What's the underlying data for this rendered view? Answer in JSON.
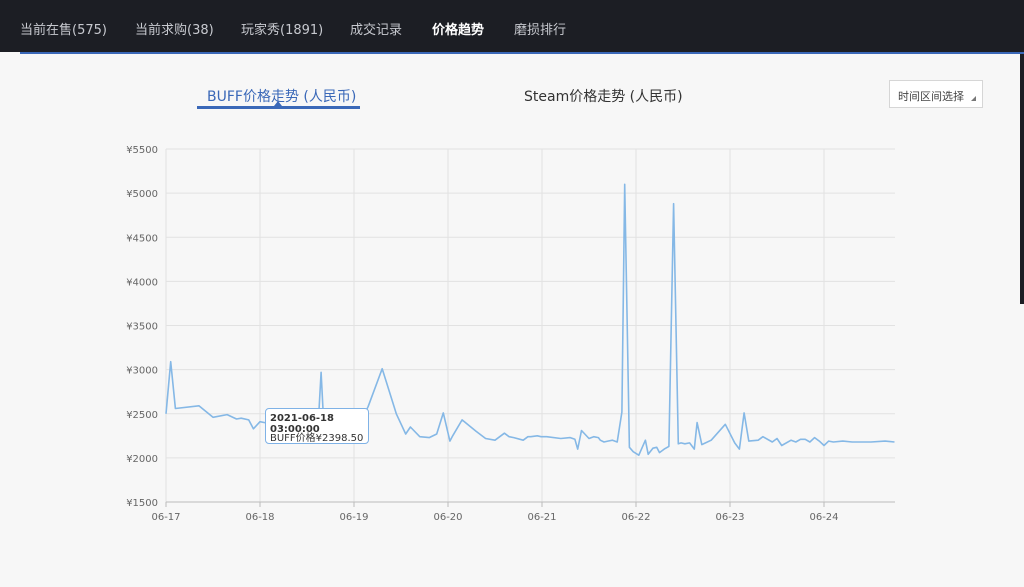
{
  "nav": {
    "tabs": [
      {
        "label": "当前在售(575)"
      },
      {
        "label": "当前求购(38)"
      },
      {
        "label": "玩家秀(1891)"
      },
      {
        "label": "成交记录"
      },
      {
        "label": "价格趋势"
      },
      {
        "label": "磨损排行"
      }
    ],
    "active_index": 4
  },
  "chart_tabs": {
    "buff_label": "BUFF价格走势 (人民币)",
    "steam_label": "Steam价格走势 (人民币)",
    "active": "buff"
  },
  "range_select": {
    "label": "时间区间选择"
  },
  "tooltip": {
    "time": "2021-06-18 03:00:00",
    "text": "BUFF价格¥2398.50"
  },
  "colors": {
    "accent": "#3a68b8",
    "line": "#85b8e6",
    "topbar": "#1c1e24"
  },
  "chart_data": {
    "type": "line",
    "ylim": [
      1500,
      5500
    ],
    "yticks": [
      "¥5500",
      "¥5000",
      "¥4500",
      "¥4000",
      "¥3500",
      "¥3000",
      "¥2500",
      "¥2000",
      "¥1500"
    ],
    "xticks": [
      "06-17",
      "06-18",
      "06-19",
      "06-20",
      "06-21",
      "06-22",
      "06-23",
      "06-24"
    ],
    "x_start": "2021-06-17 00:00",
    "grid": true,
    "series": [
      {
        "x": [
          0,
          0.05,
          0.1,
          0.35,
          0.5,
          0.65,
          0.75,
          0.8,
          0.88,
          0.93,
          1.0,
          1.05,
          1.15,
          1.25,
          1.4,
          1.5,
          1.55,
          1.62,
          1.65,
          1.68,
          1.72,
          1.8,
          1.9,
          1.98,
          2.05,
          2.15,
          2.3,
          2.45,
          2.55,
          2.6,
          2.7,
          2.8,
          2.88,
          2.95,
          3.02,
          3.05,
          3.15,
          3.3,
          3.4,
          3.5,
          3.6,
          3.65,
          3.7,
          3.8,
          3.85,
          3.88,
          3.95,
          3.99,
          4.05,
          4.2,
          4.3,
          4.35,
          4.38,
          4.42,
          4.5,
          4.55,
          4.6,
          4.62,
          4.66,
          4.7,
          4.75,
          4.8,
          4.85,
          4.88,
          4.93,
          4.97,
          5.03,
          5.1,
          5.13,
          5.18,
          5.22,
          5.25,
          5.3,
          5.35,
          5.4,
          5.45,
          5.48,
          5.52,
          5.57,
          5.62,
          5.65,
          5.7,
          5.8,
          5.95,
          6.05,
          6.1,
          6.15,
          6.2,
          6.3,
          6.35,
          6.45,
          6.5,
          6.55,
          6.65,
          6.7,
          6.75,
          6.8,
          6.85,
          6.9,
          6.95,
          7.0,
          7.05,
          7.1,
          7.2,
          7.3,
          7.5,
          7.65,
          7.75
        ],
        "y": [
          2500,
          3090,
          2560,
          2590,
          2460,
          2490,
          2440,
          2450,
          2430,
          2330,
          2410,
          2400,
          2380,
          2370,
          2360,
          2390,
          2370,
          2400,
          2970,
          2350,
          2290,
          2300,
          2240,
          2260,
          2370,
          2580,
          3010,
          2500,
          2270,
          2350,
          2240,
          2230,
          2270,
          2510,
          2190,
          2250,
          2430,
          2300,
          2220,
          2200,
          2280,
          2240,
          2230,
          2200,
          2240,
          2240,
          2250,
          2240,
          2240,
          2220,
          2230,
          2210,
          2100,
          2310,
          2220,
          2240,
          2230,
          2200,
          2180,
          2190,
          2200,
          2180,
          2520,
          5100,
          2120,
          2070,
          2030,
          2200,
          2040,
          2110,
          2120,
          2060,
          2100,
          2130,
          4880,
          2160,
          2170,
          2160,
          2170,
          2100,
          2400,
          2150,
          2200,
          2380,
          2170,
          2100,
          2510,
          2190,
          2200,
          2240,
          2180,
          2220,
          2140,
          2200,
          2180,
          2210,
          2210,
          2180,
          2230,
          2190,
          2140,
          2190,
          2180,
          2190,
          2180,
          2180,
          2190,
          2180
        ]
      }
    ],
    "highlight": {
      "x": 1.125,
      "y": 2398.5
    }
  }
}
